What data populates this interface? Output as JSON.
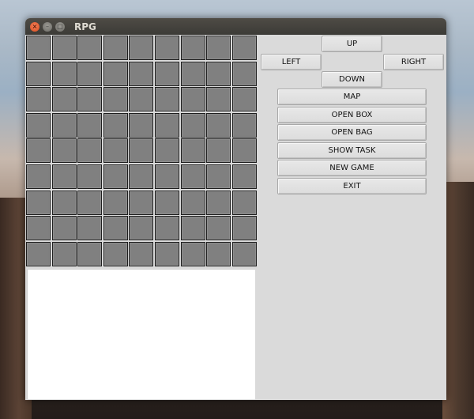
{
  "window": {
    "title": "RPG",
    "controls": {
      "close": "×",
      "minimize": "–",
      "maximize": "□"
    }
  },
  "grid": {
    "rows": 9,
    "columns": 9,
    "cell_color": "#808080"
  },
  "log": {
    "value": ""
  },
  "direction_buttons": {
    "up": "UP",
    "left": "LEFT",
    "right": "RIGHT",
    "down": "DOWN"
  },
  "action_buttons": {
    "map": "MAP",
    "open_box": "OPEN BOX",
    "open_bag": "OPEN BAG",
    "show_task": "SHOW TASK",
    "new_game": "NEW GAME",
    "exit": "EXIT"
  }
}
